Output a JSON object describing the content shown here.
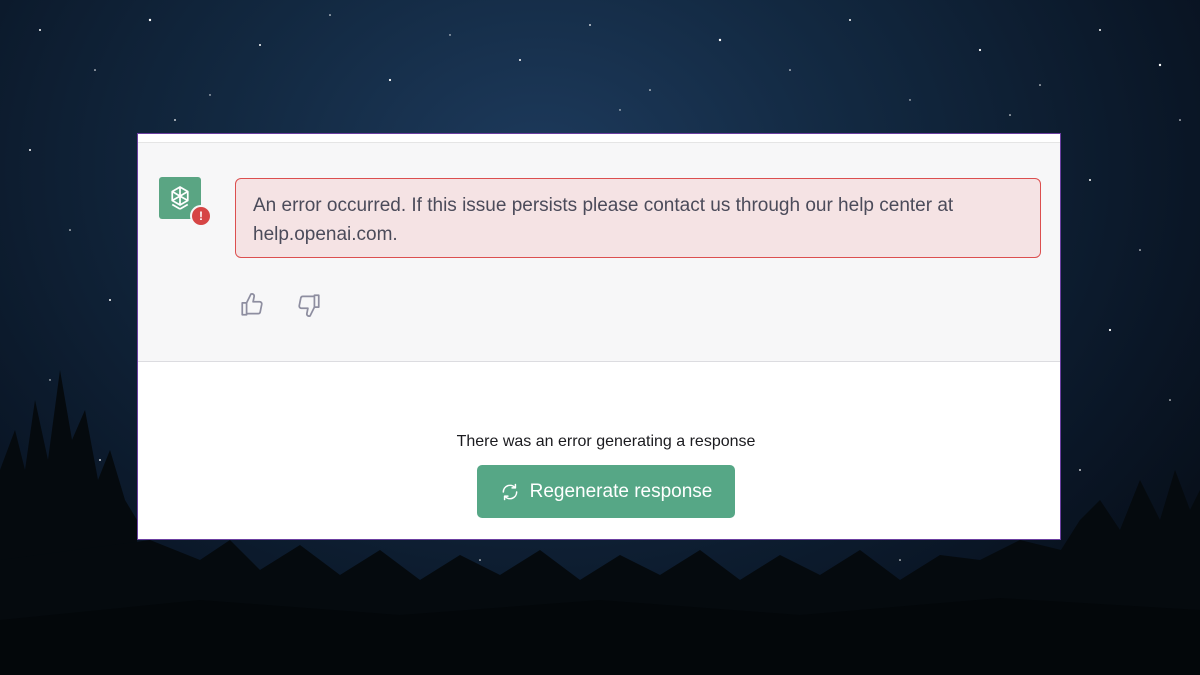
{
  "error_message": "An error occurred. If this issue persists please contact us through our help center at help.openai.com.",
  "warning_badge": "!",
  "feedback": {
    "like_icon": "thumbs-up-icon",
    "dislike_icon": "thumbs-down-icon"
  },
  "status_text": "There was an error generating a response",
  "regenerate_label": "Regenerate response",
  "colors": {
    "brand_green": "#56a786",
    "error_border": "#dc4f4f",
    "error_bg": "#f5e3e4",
    "badge_red": "#d64545"
  }
}
